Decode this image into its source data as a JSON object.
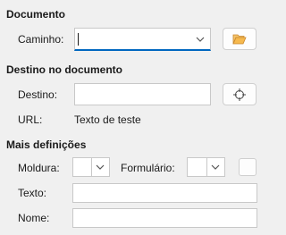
{
  "sections": {
    "documento": {
      "title": "Documento",
      "path_label": "Caminho:",
      "path_value": ""
    },
    "destino": {
      "title": "Destino no documento",
      "target_label": "Destino:",
      "target_value": "",
      "url_label": "URL:",
      "url_value": "Texto de teste"
    },
    "mais": {
      "title": "Mais definições",
      "frame_label": "Moldura:",
      "frame_value": "",
      "form_label": "Formulário:",
      "form_value": "",
      "text_label": "Texto:",
      "text_value": "",
      "name_label": "Nome:",
      "name_value": ""
    }
  },
  "icons": {
    "open_folder": "folder-open-icon",
    "target": "crosshair-target-icon",
    "chevron": "chevron-down-icon"
  },
  "colors": {
    "accent": "#0067c0",
    "folder": "#e8a33b"
  }
}
